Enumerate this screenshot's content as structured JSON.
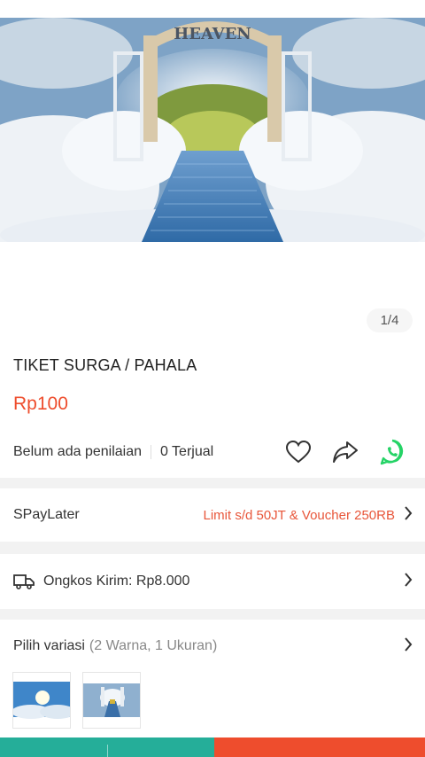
{
  "hero": {
    "gate_text": "HEAVEN"
  },
  "gallery": {
    "pager": "1/4"
  },
  "product": {
    "title": "TIKET SURGA / PAHALA",
    "price": "Rp100",
    "rating_text": "Belum ada penilaian",
    "sold_text": "0 Terjual"
  },
  "actions": {
    "icons": [
      "heart-icon",
      "share-icon",
      "whatsapp-icon"
    ],
    "whatsapp_color": "#25d366"
  },
  "spaylater": {
    "label": "SPayLater",
    "promo": "Limit s/d 50JT & Voucher 250RB"
  },
  "shipping": {
    "label": "Ongkos Kirim: Rp8.000"
  },
  "variation": {
    "label": "Pilih variasi",
    "detail": "(2 Warna, 1 Ukuran)"
  },
  "colors": {
    "accent": "#ee4d2d",
    "chat_bar": "#25ae99"
  }
}
